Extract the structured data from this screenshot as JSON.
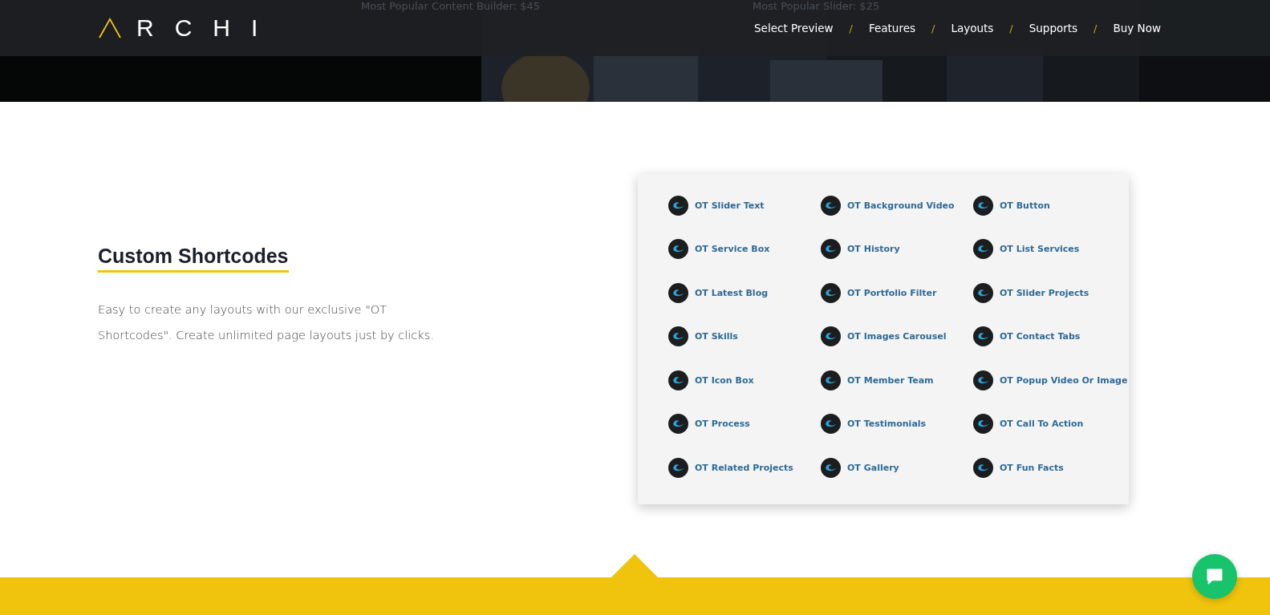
{
  "header": {
    "logo": "RCHI",
    "nav": [
      {
        "label": "Select Preview",
        "separator": "/"
      },
      {
        "label": "Features",
        "separator": "/"
      },
      {
        "label": "Layouts",
        "separator": "/"
      },
      {
        "label": "Supports",
        "separator": "/"
      },
      {
        "label": "Buy Now"
      }
    ]
  },
  "hero": {
    "captions": [
      "Most Popular Content Builder: $45",
      "Most Popular Slider: $25"
    ]
  },
  "section": {
    "title": "Custom Shortcodes",
    "text": "Easy to create any layouts with our exclusive \"OT Shortcodes\". Create unlimited page layouts just by clicks."
  },
  "shortcodes": [
    "OT Slider Text",
    "OT Background Video",
    "OT Button",
    "OT Service Box",
    "OT History",
    "OT List Services",
    "OT Latest Blog",
    "OT Portfolio Filter",
    "OT Slider Projects",
    "OT Skills",
    "OT Images Carousel",
    "OT Contact Tabs",
    "OT Icon Box",
    "OT Member Team",
    "OT Popup Video Or Image",
    "OT Process",
    "OT Testimonials",
    "OT Call To Action",
    "OT Related Projects",
    "OT Gallery",
    "OT Fun Facts"
  ]
}
